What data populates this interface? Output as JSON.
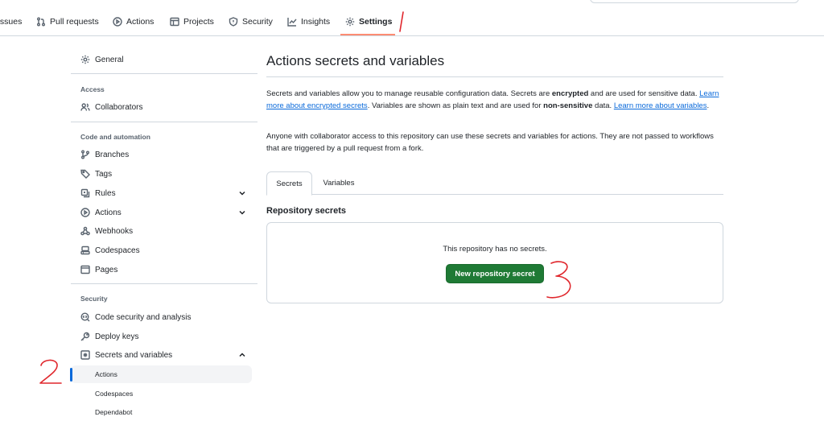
{
  "repo_nav": {
    "items": [
      {
        "label": "Issues",
        "icon": "issue-icon"
      },
      {
        "label": "Pull requests",
        "icon": "pull-request-icon"
      },
      {
        "label": "Actions",
        "icon": "play-icon"
      },
      {
        "label": "Projects",
        "icon": "table-icon"
      },
      {
        "label": "Security",
        "icon": "shield-icon"
      },
      {
        "label": "Insights",
        "icon": "graph-icon"
      },
      {
        "label": "Settings",
        "icon": "gear-icon"
      }
    ],
    "selected": "Settings"
  },
  "sidebar": {
    "general": "General",
    "access_heading": "Access",
    "collaborators": "Collaborators",
    "code_automation_heading": "Code and automation",
    "branches": "Branches",
    "tags": "Tags",
    "rules": "Rules",
    "actions": "Actions",
    "webhooks": "Webhooks",
    "codespaces": "Codespaces",
    "pages": "Pages",
    "security_heading": "Security",
    "code_security": "Code security and analysis",
    "deploy_keys": "Deploy keys",
    "secrets_variables": "Secrets and variables",
    "sub_items": [
      "Actions",
      "Codespaces",
      "Dependabot"
    ],
    "active_sub_item": "Actions"
  },
  "main": {
    "title": "Actions secrets and variables",
    "intro": {
      "part1": "Secrets and variables allow you to manage reusable configuration data. Secrets are ",
      "bold1": "encrypted",
      "part2": " and are used for sensitive data. ",
      "link1": "Learn more about encrypted secrets",
      "part3": ". Variables are shown as plain text and are used for ",
      "bold2": "non-sensitive",
      "part4": " data. ",
      "link2": "Learn more about variables",
      "part5": "."
    },
    "access_note": "Anyone with collaborator access to this repository can use these secrets and variables for actions. They are not passed to workflows that are triggered by a pull request from a fork.",
    "tabs": [
      "Secrets",
      "Variables"
    ],
    "selected_tab": "Secrets",
    "section_title": "Repository secrets",
    "empty_state": "This repository has no secrets.",
    "new_secret_button": "New repository secret"
  },
  "colors": {
    "accent_blue": "#0969da",
    "primary_green": "#1f7a35",
    "annotation_red": "#e0262c",
    "nav_underline": "#fd8c73"
  }
}
